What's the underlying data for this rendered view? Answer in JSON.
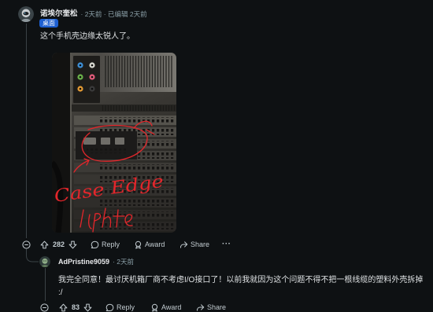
{
  "colors": {
    "background": "#0e1113",
    "text": "#dfe2e4",
    "meta": "#8ba0a8",
    "flair": "#1d5fd1",
    "thread_line": "#3a4246",
    "annotation": "#e3262b",
    "action": "#c3ccd1"
  },
  "icons": {
    "collapse": "collapse-icon",
    "upvote": "upvote-icon",
    "downvote": "downvote-icon",
    "reply": "comment-icon",
    "award": "award-icon",
    "share": "share-icon"
  },
  "comment": {
    "author": "诺埃尔奎松",
    "meta": "· 2天前 · 已编辑 2天前",
    "flair": "桌面",
    "body": "这个手机壳边缘太锐人了。",
    "image": {
      "annotation": "Case Edge"
    },
    "actions": {
      "score": "282",
      "reply": "Reply",
      "award": "Award",
      "share": "Share",
      "more": "···"
    }
  },
  "reply": {
    "author": "AdPristine9059",
    "meta": "· 2天前",
    "body": "我完全同意！最讨厌机箱厂商不考虑I/O接口了！以前我就因为这个问题不得不把一根线缆的塑料外壳拆掉 :/",
    "actions": {
      "score": "83",
      "reply": "Reply",
      "award": "Award",
      "share": "Share"
    }
  }
}
